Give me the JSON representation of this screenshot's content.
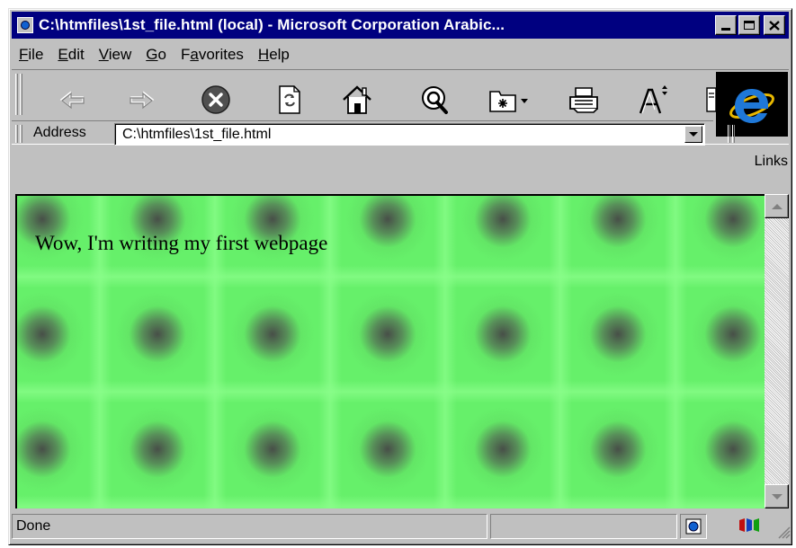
{
  "window": {
    "title": "C:\\htmfiles\\1st_file.html (local) - Microsoft Corporation Arabic...",
    "caption_buttons": {
      "minimize": "_",
      "maximize": "□",
      "close": "X"
    }
  },
  "menu": [
    {
      "label": "File",
      "underline": "F",
      "rest": "ile"
    },
    {
      "label": "Edit",
      "underline": "E",
      "rest": "dit"
    },
    {
      "label": "View",
      "underline": "V",
      "rest": "iew"
    },
    {
      "label": "Go",
      "underline": "G",
      "rest": "o"
    },
    {
      "label": "Favorites",
      "pre": "F",
      "underline": "a",
      "rest": "vorites"
    },
    {
      "label": "Help",
      "underline": "H",
      "rest": "elp"
    }
  ],
  "toolbar": {
    "icons": [
      "back-icon",
      "forward-icon",
      "stop-icon",
      "refresh-icon",
      "home-icon",
      "search-icon",
      "favorites-icon",
      "print-icon",
      "font-icon",
      "mail-icon"
    ]
  },
  "address": {
    "label": "Address",
    "value": "C:\\htmfiles\\1st_file.html",
    "links_label": "Links"
  },
  "content": {
    "text": "Wow, I'm writing my first webpage",
    "background_color": "#66f06a"
  },
  "status": {
    "text": "Done"
  }
}
